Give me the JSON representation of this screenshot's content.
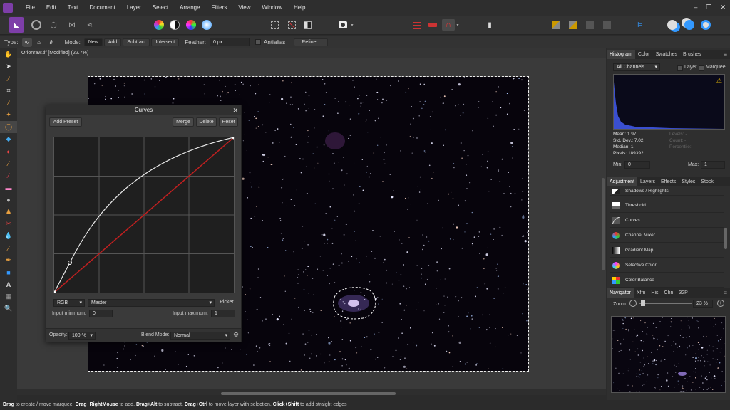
{
  "menubar": {
    "items": [
      "File",
      "Edit",
      "Text",
      "Document",
      "Layer",
      "Select",
      "Arrange",
      "Filters",
      "View",
      "Window",
      "Help"
    ],
    "window_controls": [
      "–",
      "❐",
      "✕"
    ]
  },
  "context": {
    "type_label": "Type:",
    "mode_label": "Mode:",
    "modes": [
      "New",
      "Add",
      "Subtract",
      "Intersect"
    ],
    "active_mode": "New",
    "feather_label": "Feather:",
    "feather_value": "0 px",
    "antialias_label": "Antialias",
    "refine_label": "Refine..."
  },
  "document": {
    "tab_title": "Orionraw.tif [Modified] (22.7%)"
  },
  "curves": {
    "title": "Curves",
    "close": "✕",
    "add_preset": "Add Preset",
    "merge": "Merge",
    "delete": "Delete",
    "reset": "Reset",
    "channel": "RGB",
    "target": "Master",
    "picker": "Picker",
    "input_min_label": "Input minimum:",
    "input_min_value": "0",
    "input_max_label": "Input maximum:",
    "input_max_value": "1",
    "opacity_label": "Opacity:",
    "opacity_value": "100 %",
    "blend_label": "Blend Mode:",
    "blend_value": "Normal",
    "line_color": "#c02020"
  },
  "histogram": {
    "tabs": [
      "Histogram",
      "Color",
      "Swatches",
      "Brushes"
    ],
    "channel_select": "All Channels",
    "layer_label": "Layer",
    "marquee_label": "Marquee",
    "warning_icon": "warning-icon",
    "stats": {
      "mean": "Mean: 1.97",
      "std": "Std. Dev.: 7.02",
      "median": "Median: 1",
      "pixels": "Pixels: 189392",
      "levels": "Levels: -",
      "count": "Count: -",
      "percentile": "Percentile: -"
    },
    "min_label": "Min:",
    "min_value": "0",
    "max_label": "Max:",
    "max_value": "1"
  },
  "adjustments": {
    "tabs": [
      "Adjustment",
      "Layers",
      "Effects",
      "Styles",
      "Stock"
    ],
    "items": [
      "Shadows / Highlights",
      "Threshold",
      "Curves",
      "Channel Mixer",
      "Gradient Map",
      "Selective Color",
      "Color Balance"
    ]
  },
  "navigator": {
    "tabs": [
      "Navigator",
      "Xfm",
      "His",
      "Chn",
      "32P"
    ],
    "zoom_label": "Zoom:",
    "zoom_value": "23 %"
  },
  "status": {
    "parts": [
      {
        "b": "Drag",
        "t": " to create / move marquee. "
      },
      {
        "b": "Drag+RightMouse",
        "t": " to add. "
      },
      {
        "b": "Drag+Alt",
        "t": " to subtract. "
      },
      {
        "b": "Drag+Ctrl",
        "t": " to move layer with selection. "
      },
      {
        "b": "Click+Shift",
        "t": " to add straight edges"
      }
    ]
  }
}
